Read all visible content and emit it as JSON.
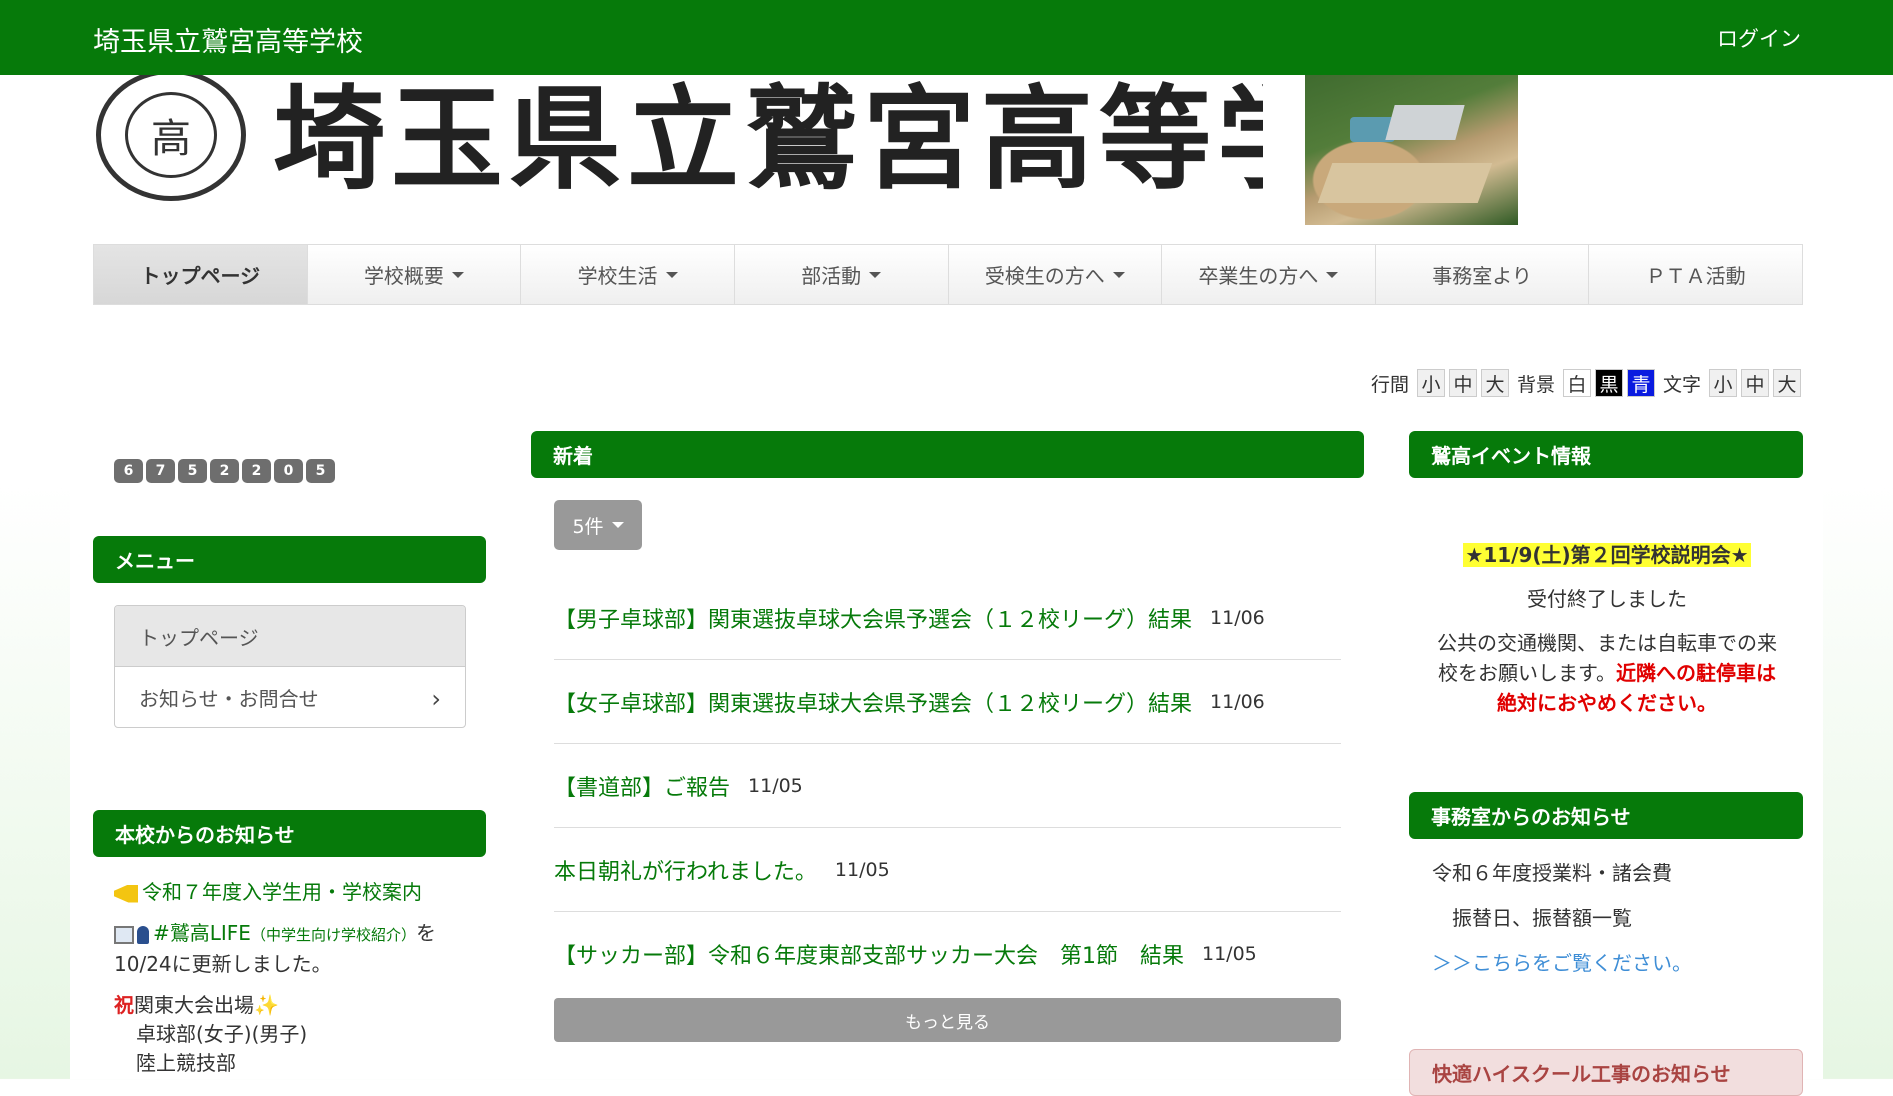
{
  "header": {
    "site_title": "埼玉県立鷲宮高等学校",
    "login": "ログイン",
    "banner_text": "埼玉県立鷲宮高等学校",
    "emblem_char": "高",
    "accent_color": "#067a0a"
  },
  "nav": {
    "items": [
      {
        "label": "トップページ"
      },
      {
        "label": "学校概要"
      },
      {
        "label": "学校生活"
      },
      {
        "label": "部活動"
      },
      {
        "label": "受検生の方へ"
      },
      {
        "label": "卒業生の方へ"
      },
      {
        "label": "事務室より"
      },
      {
        "label": "ＰＴＡ活動"
      }
    ]
  },
  "a11y": {
    "line_label": "行間",
    "bg_label": "背景",
    "text_label": "文字",
    "small": "小",
    "medium": "中",
    "large": "大",
    "white": "白",
    "black": "黒",
    "blue": "青"
  },
  "counter": {
    "digits": [
      "6",
      "7",
      "5",
      "2",
      "2",
      "0",
      "5"
    ]
  },
  "left": {
    "menu_heading": "メニュー",
    "menu_items": [
      {
        "label": "トップページ"
      },
      {
        "label": "お知らせ・お問合せ"
      }
    ],
    "notices_heading": "本校からのお知らせ",
    "notice1": "令和７年度入学生用・学校案内",
    "notice2_link": "#鷲高LIFE",
    "notice2_small": "（中学生向け学校紹介）",
    "notice2_rest": "を10/24に更新しました。",
    "notice3_prefix": "祝",
    "notice3": "関東大会出場",
    "notice3_line2": "卓球部(女子)(男子)",
    "notice3_line3": "陸上競技部"
  },
  "center": {
    "heading": "新着",
    "count_button": "5件",
    "posts": [
      {
        "title": "【男子卓球部】関東選抜卓球大会県予選会（１２校リーグ）結果",
        "date": "11/06"
      },
      {
        "title": "【女子卓球部】関東選抜卓球大会県予選会（１２校リーグ）結果",
        "date": "11/06"
      },
      {
        "title": "【書道部】ご報告",
        "date": "11/05"
      },
      {
        "title": "本日朝礼が行われました。",
        "date": "11/05"
      },
      {
        "title": "【サッカー部】令和６年度東部支部サッカー大会　第1節　結果",
        "date": "11/05"
      }
    ],
    "more": "もっと見る"
  },
  "right": {
    "event_heading": "鷲高イベント情報",
    "event_highlight": "★11/9(土)第２回学校説明会★",
    "event_closed": "受付終了しました",
    "event_note": "公共の交通機関、または自転車での来校をお願いします。",
    "event_warning": "近隣への駐停車は絶対におやめください。",
    "office_heading": "事務室からのお知らせ",
    "office_line1": "令和６年度授業料・諸会費",
    "office_line2": "振替日、振替額一覧",
    "office_link": "＞＞こちらをご覧ください。",
    "construction_heading": "快適ハイスクール工事のお知らせ"
  }
}
